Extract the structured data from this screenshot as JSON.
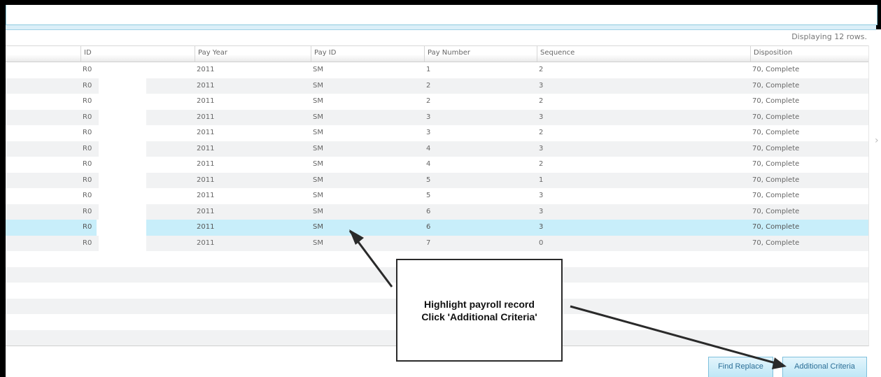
{
  "grid": {
    "row_count_text": "Displaying 12 rows.",
    "columns": [
      "ID",
      "Pay Year",
      "Pay ID",
      "Pay Number",
      "Sequence",
      "Disposition"
    ],
    "rows": [
      {
        "id": "R0",
        "pay_year": "2011",
        "pay_id": "SM",
        "pay_number": "1",
        "sequence": "2",
        "disposition": "70, Complete"
      },
      {
        "id": "R0",
        "pay_year": "2011",
        "pay_id": "SM",
        "pay_number": "2",
        "sequence": "3",
        "disposition": "70, Complete"
      },
      {
        "id": "R0",
        "pay_year": "2011",
        "pay_id": "SM",
        "pay_number": "2",
        "sequence": "2",
        "disposition": "70, Complete"
      },
      {
        "id": "R0",
        "pay_year": "2011",
        "pay_id": "SM",
        "pay_number": "3",
        "sequence": "3",
        "disposition": "70, Complete"
      },
      {
        "id": "R0",
        "pay_year": "2011",
        "pay_id": "SM",
        "pay_number": "3",
        "sequence": "2",
        "disposition": "70, Complete"
      },
      {
        "id": "R0",
        "pay_year": "2011",
        "pay_id": "SM",
        "pay_number": "4",
        "sequence": "3",
        "disposition": "70, Complete"
      },
      {
        "id": "R0",
        "pay_year": "2011",
        "pay_id": "SM",
        "pay_number": "4",
        "sequence": "2",
        "disposition": "70, Complete"
      },
      {
        "id": "R0",
        "pay_year": "2011",
        "pay_id": "SM",
        "pay_number": "5",
        "sequence": "1",
        "disposition": "70, Complete"
      },
      {
        "id": "R0",
        "pay_year": "2011",
        "pay_id": "SM",
        "pay_number": "5",
        "sequence": "3",
        "disposition": "70, Complete"
      },
      {
        "id": "R0",
        "pay_year": "2011",
        "pay_id": "SM",
        "pay_number": "6",
        "sequence": "3",
        "disposition": "70, Complete"
      },
      {
        "id": "R0",
        "pay_year": "2011",
        "pay_id": "SM",
        "pay_number": "6",
        "sequence": "3",
        "disposition": "70, Complete"
      },
      {
        "id": "R0",
        "pay_year": "2011",
        "pay_id": "SM",
        "pay_number": "7",
        "sequence": "0",
        "disposition": "70, Complete"
      }
    ],
    "selected_row": 11
  },
  "buttons": {
    "find_replace": "Find Replace",
    "additional_criteria": "Additional Criteria"
  },
  "callout": {
    "text": "Highlight payroll record\nClick 'Additional Criteria'"
  },
  "colors": {
    "selected_row": "#c8eefa",
    "alt_row": "#f1f2f3",
    "button_text": "#2d6f97",
    "accent_border": "#8ecbe0"
  },
  "icons": {
    "scroll": "chevron-right-icon"
  }
}
